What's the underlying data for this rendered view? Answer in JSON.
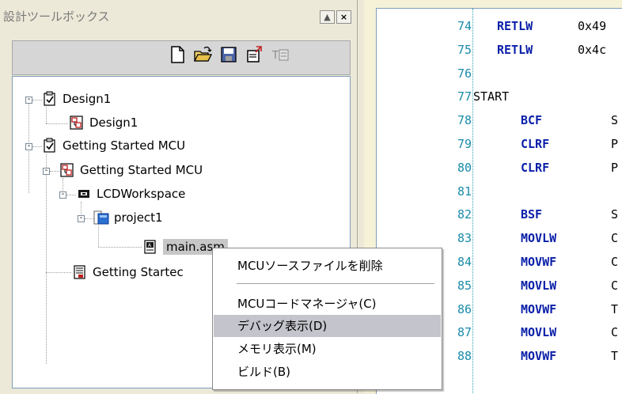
{
  "toolbox": {
    "title": "設計ツールボックス",
    "window_buttons": {
      "restore": "▲",
      "close": "×"
    },
    "toolbar_icons": [
      "new-file-icon",
      "open-folder-icon",
      "save-icon",
      "export-icon",
      "text-editor-icon"
    ]
  },
  "tree": {
    "items": [
      {
        "label": "Design1",
        "icon": "checked-document-icon"
      },
      {
        "label": "Design1",
        "icon": "diagram-document-icon"
      },
      {
        "label": "Getting Started MCU",
        "icon": "checked-document-icon"
      },
      {
        "label": "Getting Started MCU",
        "icon": "diagram-document-icon"
      },
      {
        "label": "LCDWorkspace",
        "icon": "chip-icon"
      },
      {
        "label": "project1",
        "icon": "project-icon"
      },
      {
        "label": "main.asm",
        "icon": "asm-file-icon"
      },
      {
        "label": "Getting Startec",
        "icon": "report-icon"
      }
    ]
  },
  "editor": {
    "lines": [
      {
        "num": "74",
        "instr": "RETLW",
        "arg": "0x49"
      },
      {
        "num": "75",
        "instr": "RETLW",
        "arg": "0x4c"
      },
      {
        "num": "76",
        "instr": "",
        "arg": ""
      },
      {
        "num": "77",
        "label": "START"
      },
      {
        "num": "78",
        "instr": "BCF",
        "arg": "S"
      },
      {
        "num": "79",
        "instr": "CLRF",
        "arg": "P"
      },
      {
        "num": "80",
        "instr": "CLRF",
        "arg": "P"
      },
      {
        "num": "81",
        "instr": "",
        "arg": ""
      },
      {
        "num": "82",
        "instr": "BSF",
        "arg": "S"
      },
      {
        "num": "83",
        "instr": "MOVLW",
        "arg": "C"
      },
      {
        "num": "84",
        "instr": "MOVWF",
        "arg": "C"
      },
      {
        "num": "85",
        "instr": "MOVLW",
        "arg": "C"
      },
      {
        "num": "86",
        "instr": "MOVWF",
        "arg": "T"
      },
      {
        "num": "87",
        "instr": "MOVLW",
        "arg": "C"
      },
      {
        "num": "88",
        "instr": "MOVWF",
        "arg": "T"
      }
    ]
  },
  "context_menu": {
    "items": [
      {
        "label": "MCUソースファイルを削除",
        "highlighted": false
      },
      {
        "label": "MCUコードマネージャ(C)",
        "highlighted": false
      },
      {
        "label": "デバッグ表示(D)",
        "highlighted": true
      },
      {
        "label": "メモリ表示(M)",
        "highlighted": false
      },
      {
        "label": "ビルド(B)",
        "highlighted": false
      }
    ]
  },
  "colors": {
    "panel_bg": "#ece9d8",
    "editor_bg": "#f5f2d8",
    "line_number": "#1a8ca8",
    "keyword": "#0a1fa8",
    "menu_highlight": "#c4c4cc"
  }
}
